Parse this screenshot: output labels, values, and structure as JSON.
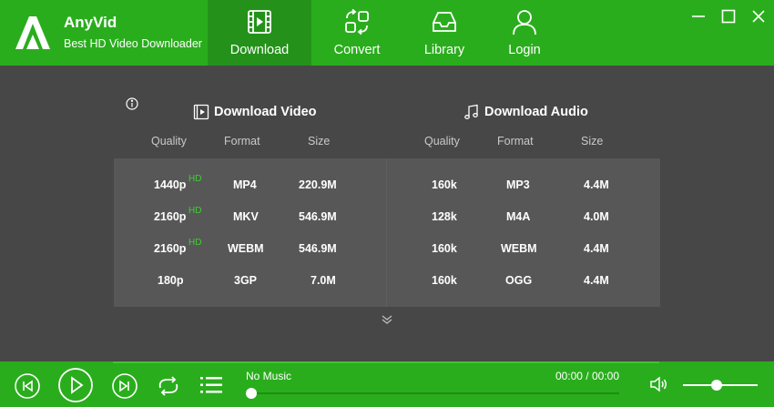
{
  "app": {
    "name": "AnyVid",
    "subtitle": "Best HD Video Downloader"
  },
  "nav": [
    {
      "label": "Download",
      "icon": "video-file-icon",
      "active": true
    },
    {
      "label": "Convert",
      "icon": "convert-icon",
      "active": false
    },
    {
      "label": "Library",
      "icon": "inbox-icon",
      "active": false
    },
    {
      "label": "Login",
      "icon": "user-icon",
      "active": false
    }
  ],
  "video": {
    "title": "Download Video",
    "headers": {
      "quality": "Quality",
      "format": "Format",
      "size": "Size"
    },
    "rows": [
      {
        "quality": "1440p",
        "hd": "HD",
        "format": "MP4",
        "size": "220.9M"
      },
      {
        "quality": "2160p",
        "hd": "HD",
        "format": "MKV",
        "size": "546.9M"
      },
      {
        "quality": "2160p",
        "hd": "HD",
        "format": "WEBM",
        "size": "546.9M"
      },
      {
        "quality": "180p",
        "hd": "",
        "format": "3GP",
        "size": "7.0M"
      }
    ]
  },
  "audio": {
    "title": "Download Audio",
    "headers": {
      "quality": "Quality",
      "format": "Format",
      "size": "Size"
    },
    "rows": [
      {
        "quality": "160k",
        "format": "MP3",
        "size": "4.4M"
      },
      {
        "quality": "128k",
        "format": "M4A",
        "size": "4.0M"
      },
      {
        "quality": "160k",
        "format": "WEBM",
        "size": "4.4M"
      },
      {
        "quality": "160k",
        "format": "OGG",
        "size": "4.4M"
      }
    ]
  },
  "player": {
    "track": "No Music",
    "time": "00:00 / 00:00",
    "progress": 0,
    "volume": 0.45
  },
  "colors": {
    "accent": "#2aad1d",
    "accent_dark": "#24921a",
    "hd_badge": "#3fcf34",
    "background": "#474747",
    "table": "#575757"
  }
}
